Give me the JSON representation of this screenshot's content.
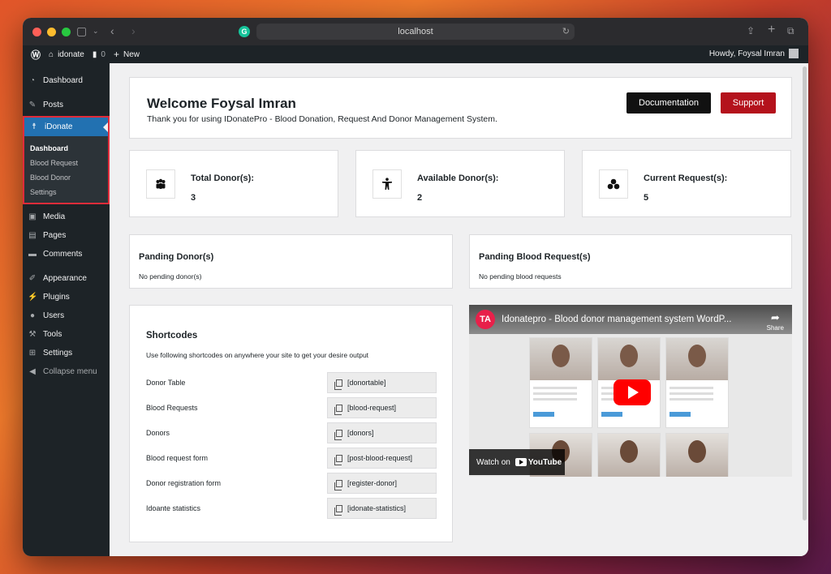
{
  "browser": {
    "url": "localhost"
  },
  "adminbar": {
    "site": "idonate",
    "comments": "0",
    "new": "New",
    "howdy": "Howdy, Foysal Imran"
  },
  "sidebar": {
    "dashboard": "Dashboard",
    "posts": "Posts",
    "idonate": "iDonate",
    "submenu": [
      "Dashboard",
      "Blood Request",
      "Blood Donor",
      "Settings"
    ],
    "media": "Media",
    "pages": "Pages",
    "comments": "Comments",
    "appearance": "Appearance",
    "plugins": "Plugins",
    "users": "Users",
    "tools": "Tools",
    "settings": "Settings",
    "collapse": "Collapse menu"
  },
  "welcome": {
    "title": "Welcome Foysal Imran",
    "subtitle": "Thank you for using IDonatePro - Blood Donation, Request And Donor Management System.",
    "documentation": "Documentation",
    "support": "Support"
  },
  "stats": [
    {
      "label": "Total Donor(s):",
      "value": "3"
    },
    {
      "label": "Available Donor(s):",
      "value": "2"
    },
    {
      "label": "Current Request(s):",
      "value": "5"
    }
  ],
  "pending": {
    "donor_title": "Panding Donor(s)",
    "donor_text": "No pending donor(s)",
    "request_title": "Panding Blood Request(s)",
    "request_text": "No pending blood requests"
  },
  "shortcodes": {
    "title": "Shortcodes",
    "description": "Use following shortcodes on anywhere your site to get your desire output",
    "rows": [
      {
        "label": "Donor Table",
        "code": "[donortable]"
      },
      {
        "label": "Blood Requests",
        "code": "[blood-request]"
      },
      {
        "label": "Donors",
        "code": "[donors]"
      },
      {
        "label": "Blood request form",
        "code": "[post-blood-request]"
      },
      {
        "label": "Donor registration form",
        "code": "[register-donor]"
      },
      {
        "label": "Idoante statistics",
        "code": "[idonate-statistics]"
      }
    ]
  },
  "video": {
    "title": "Idonatepro - Blood donor management system WordP...",
    "share": "Share",
    "watch_on": "Watch on",
    "youtube": "YouTube",
    "logo_text": "TA"
  }
}
